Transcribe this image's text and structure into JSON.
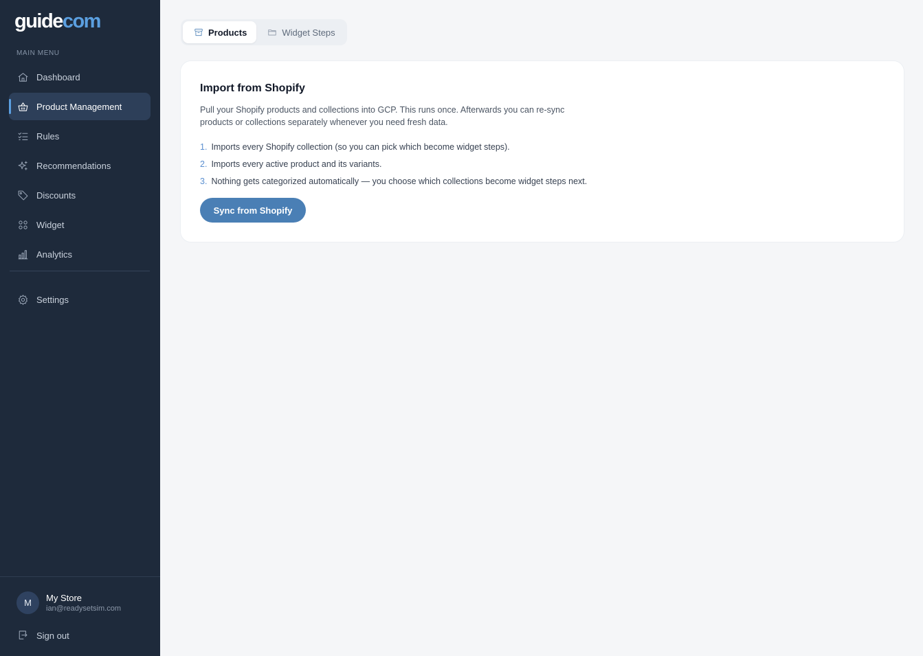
{
  "brand": {
    "logo_part1": "guide",
    "logo_part2": "com"
  },
  "sidebar": {
    "menu_heading": "MAIN MENU",
    "items": [
      {
        "label": "Dashboard",
        "icon": "home-icon",
        "active": false
      },
      {
        "label": "Product Management",
        "icon": "basket-icon",
        "active": true
      },
      {
        "label": "Rules",
        "icon": "checklist-icon",
        "active": false
      },
      {
        "label": "Recommendations",
        "icon": "sparkles-icon",
        "active": false
      },
      {
        "label": "Discounts",
        "icon": "tag-icon",
        "active": false
      },
      {
        "label": "Widget",
        "icon": "grid-icon",
        "active": false
      },
      {
        "label": "Analytics",
        "icon": "bar-chart-icon",
        "active": false
      }
    ],
    "settings_label": "Settings",
    "profile": {
      "avatar_initial": "M",
      "name": "My Store",
      "email": "ian@readysetsim.com"
    },
    "signout_label": "Sign out"
  },
  "tabs": [
    {
      "label": "Products",
      "icon": "box-icon",
      "active": true
    },
    {
      "label": "Widget Steps",
      "icon": "folder-icon",
      "active": false
    }
  ],
  "import_card": {
    "title": "Import from Shopify",
    "description": "Pull your Shopify products and collections into GCP. This runs once. Afterwards you can re-sync products or collections separately whenever you need fresh data.",
    "steps": [
      {
        "num": "1.",
        "text": "Imports every Shopify collection (so you can pick which become widget steps)."
      },
      {
        "num": "2.",
        "text": "Imports every active product and its variants."
      },
      {
        "num": "3.",
        "text": "Nothing gets categorized automatically — you choose which collections become widget steps next."
      }
    ],
    "button_label": "Sync from Shopify"
  },
  "colors": {
    "sidebar_bg": "#1e2a3b",
    "sidebar_active_bg": "#2d3f59",
    "accent": "#4a7fb5",
    "logo_accent": "#5b9fe0",
    "page_bg": "#f5f6f8"
  }
}
